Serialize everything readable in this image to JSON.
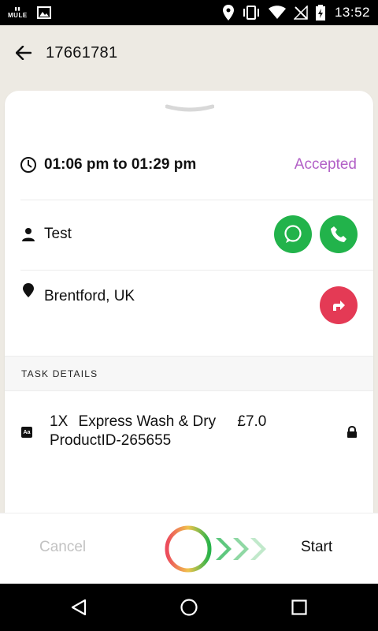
{
  "status_bar": {
    "app_badge": "MULE",
    "time": "13:52"
  },
  "header": {
    "order_id": "17661781"
  },
  "booking": {
    "time_range": "01:06 pm to 01:29 pm",
    "status": "Accepted",
    "customer_name": "Test",
    "address": "Brentford, UK"
  },
  "task_details": {
    "header": "TASK DETAILS",
    "items": [
      {
        "quantity": "1X",
        "name": "Express Wash & Dry",
        "price": "£7.0",
        "product_id": "ProductID-265655"
      }
    ]
  },
  "actions": {
    "cancel_label": "Cancel",
    "start_label": "Start"
  },
  "colors": {
    "accent_purple": "#b260c7",
    "call_green": "#22b34b",
    "navigate_red": "#e43a55",
    "background": "#edeae3"
  },
  "icons": [
    "wifi-icon",
    "signal-icon",
    "battery-icon",
    "location-icon",
    "vibrate-icon",
    "back-arrow-icon",
    "clock-icon",
    "person-icon",
    "map-pin-icon",
    "chat-icon",
    "phone-icon",
    "directions-icon",
    "font-icon",
    "lock-icon"
  ]
}
